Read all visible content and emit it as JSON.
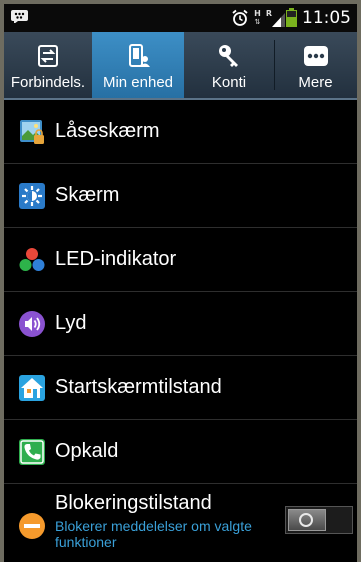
{
  "status_bar": {
    "time": "11:05",
    "network_h": "H",
    "network_r": "R",
    "battery_level": 0.55,
    "icons": [
      "bbm-icon",
      "alarm-icon",
      "signal-icon",
      "battery-icon"
    ]
  },
  "tabs": [
    {
      "label": "Forbindels.",
      "icon": "connections-icon",
      "selected": false
    },
    {
      "label": "Min enhed",
      "icon": "device-icon",
      "selected": true
    },
    {
      "label": "Konti",
      "icon": "key-icon",
      "selected": false
    },
    {
      "label": "Mere",
      "icon": "more-icon",
      "selected": false
    }
  ],
  "settings": [
    {
      "label": "Låseskærm",
      "icon": "lockscreen-icon"
    },
    {
      "label": "Skærm",
      "icon": "display-icon"
    },
    {
      "label": "LED-indikator",
      "icon": "led-icon"
    },
    {
      "label": "Lyd",
      "icon": "sound-icon"
    },
    {
      "label": "Startskærmtilstand",
      "icon": "home-icon"
    },
    {
      "label": "Opkald",
      "icon": "call-icon"
    },
    {
      "label": "Blokeringstilstand",
      "icon": "block-icon",
      "subtitle": "Blokerer meddelelser om valgte funktioner",
      "toggle": "off"
    }
  ],
  "colors": {
    "accent_blue": "#2e80b8",
    "subtitle_blue": "#3aa0d8",
    "battery_green": "#7ab21e"
  }
}
